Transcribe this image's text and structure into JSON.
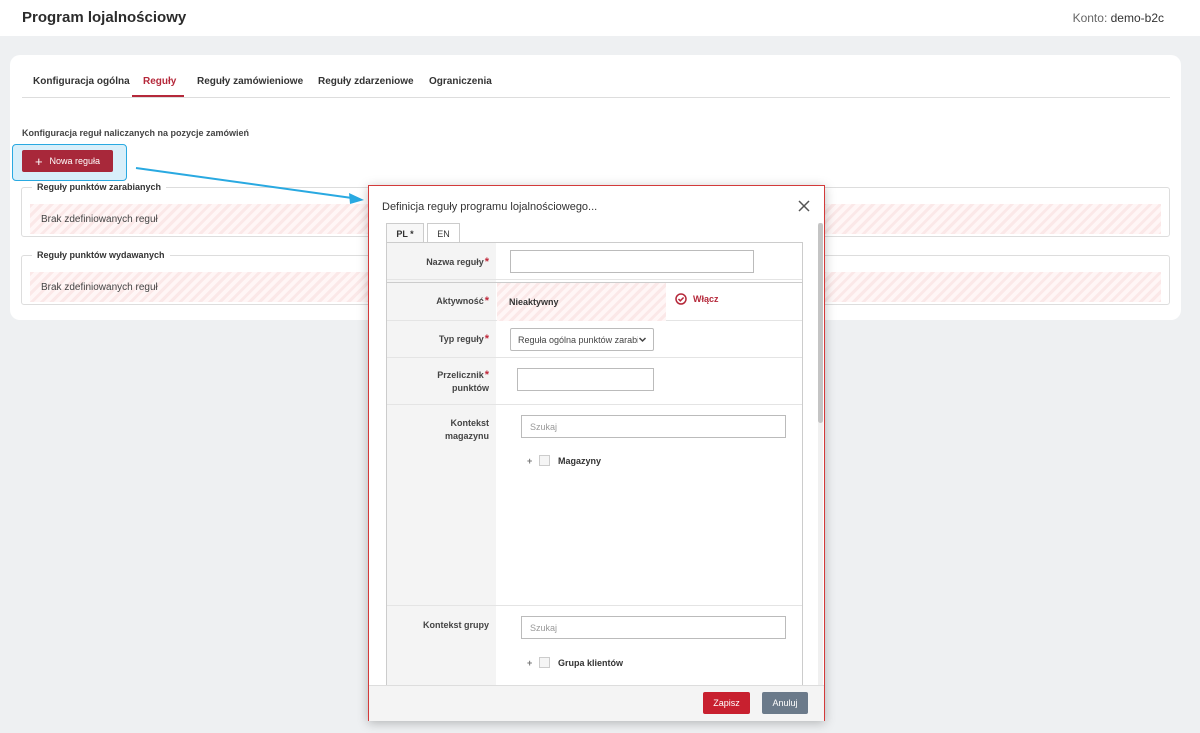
{
  "header": {
    "title": "Program lojalnościowy",
    "account_label": "Konto:",
    "account_value": "demo-b2c"
  },
  "tabs": [
    {
      "label": "Konfiguracja ogólna",
      "active": false
    },
    {
      "label": "Reguły",
      "active": true
    },
    {
      "label": "Reguły zamówieniowe",
      "active": false
    },
    {
      "label": "Reguły zdarzeniowe",
      "active": false
    },
    {
      "label": "Ograniczenia",
      "active": false
    }
  ],
  "section": {
    "description": "Konfiguracja reguł naliczanych na pozycje zamówień",
    "new_rule_label": "Nowa reguła"
  },
  "groups": [
    {
      "legend": "Reguły punktów zarabianych",
      "empty_text": "Brak zdefiniowanych reguł"
    },
    {
      "legend": "Reguły punktów wydawanych",
      "empty_text": "Brak zdefiniowanych reguł"
    }
  ],
  "modal": {
    "title": "Definicja reguły programu lojalnościowego...",
    "lang_tabs": [
      "PL *",
      "EN"
    ],
    "fields": {
      "name": {
        "label": "Nazwa reguły",
        "value": ""
      },
      "activity": {
        "label": "Aktywność",
        "status": "Nieaktywny",
        "action": "Włącz"
      },
      "type": {
        "label": "Typ reguły",
        "selected": "Reguła ogólna punktów zarabianych"
      },
      "converter": {
        "label_line1": "Przelicznik",
        "label_line2": "punktów",
        "value": ""
      },
      "warehouse_context": {
        "label_line1": "Kontekst",
        "label_line2": "magazynu",
        "search_placeholder": "Szukaj",
        "tree_root": "Magazyny"
      },
      "group_context": {
        "label": "Kontekst grupy",
        "search_placeholder": "Szukaj",
        "tree_root": "Grupa klientów"
      }
    },
    "buttons": {
      "save": "Zapisz",
      "cancel": "Anuluj"
    }
  },
  "colors": {
    "accent": "#b5283a",
    "button_primary": "#a8283a",
    "highlight": "#29a9e1",
    "cancel_button": "#6b7a8a"
  }
}
